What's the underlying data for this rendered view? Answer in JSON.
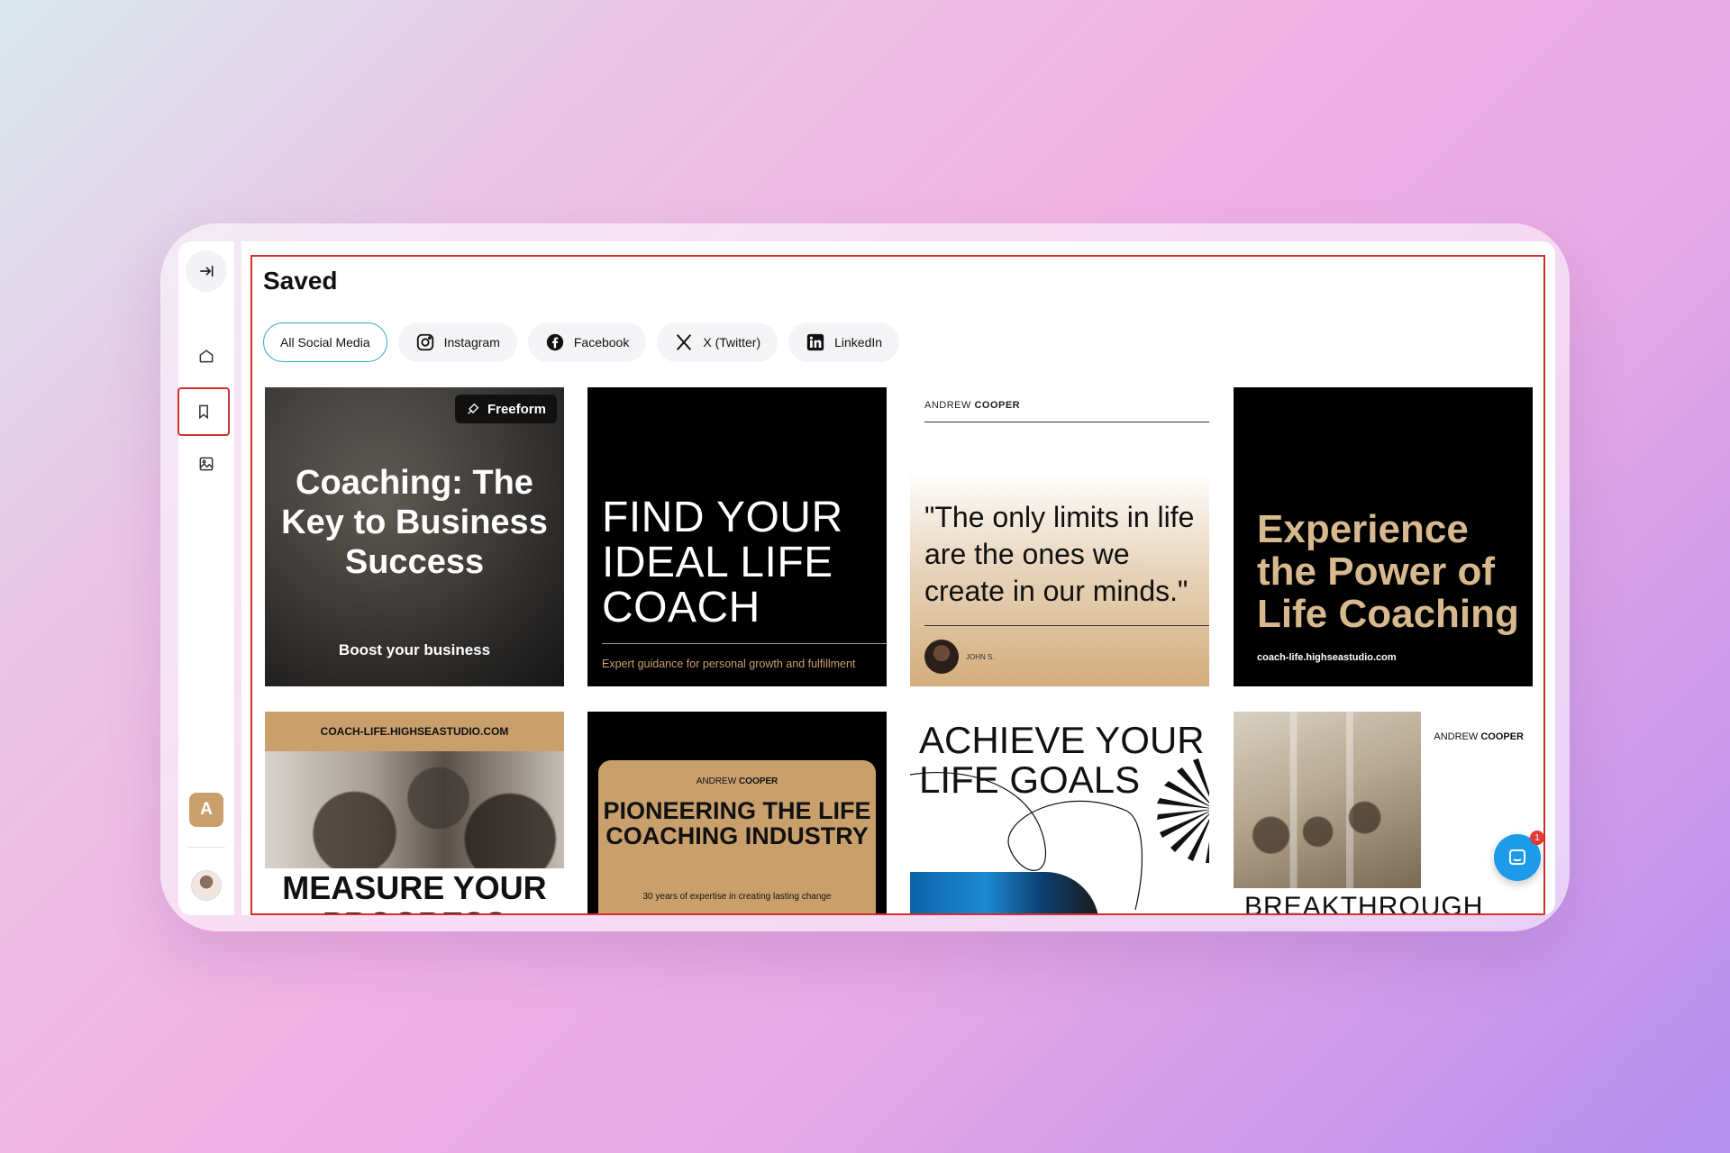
{
  "page": {
    "title": "Saved"
  },
  "sidebar": {
    "items": [
      {
        "name": "collapse",
        "icon": "collapse-sidebar-icon"
      },
      {
        "name": "home",
        "icon": "home-icon"
      },
      {
        "name": "saved",
        "icon": "bookmark-icon"
      },
      {
        "name": "media",
        "icon": "image-icon"
      }
    ],
    "workspace_initial": "A"
  },
  "tabs": [
    {
      "label": "All Social Media",
      "icon": "",
      "active": true
    },
    {
      "label": "Instagram",
      "icon": "instagram-icon",
      "active": false
    },
    {
      "label": "Facebook",
      "icon": "facebook-icon",
      "active": false
    },
    {
      "label": "X (Twitter)",
      "icon": "x-icon",
      "active": false
    },
    {
      "label": "LinkedIn",
      "icon": "linkedin-icon",
      "active": false
    }
  ],
  "cards": [
    {
      "tag": "Freeform",
      "headline": "Coaching: The Key to Business Success",
      "subline": "Boost your business"
    },
    {
      "headline": "FIND YOUR IDEAL LIFE COACH",
      "subline": "Expert guidance for personal growth and fulfillment"
    },
    {
      "brand_first": "ANDREW",
      "brand_last": "COOPER",
      "quote": "\"The only limits in life are the ones we create in our minds.\"",
      "author": "JOHN S."
    },
    {
      "headline": "Experience the Power of Life Coaching",
      "url": "coach-life.highseastudio.com"
    },
    {
      "url": "COACH-LIFE.HIGHSEASTUDIO.COM",
      "headline": "MEASURE YOUR PROGRESS"
    },
    {
      "brand_first": "ANDREW",
      "brand_last": "COOPER",
      "headline": "PIONEERING THE LIFE COACHING INDUSTRY",
      "subline": "30 years of expertise in creating lasting change"
    },
    {
      "headline": "ACHIEVE YOUR LIFE GOALS"
    },
    {
      "brand_first": "ANDREW",
      "brand_last": "COOPER",
      "headline": "BREAKTHROUGH"
    }
  ],
  "chat": {
    "badge_count": "1"
  },
  "colors": {
    "accent": "#2aa6c8",
    "gold": "#c9a06b",
    "highlight": "#d32f2f",
    "chat": "#1e9be8"
  }
}
